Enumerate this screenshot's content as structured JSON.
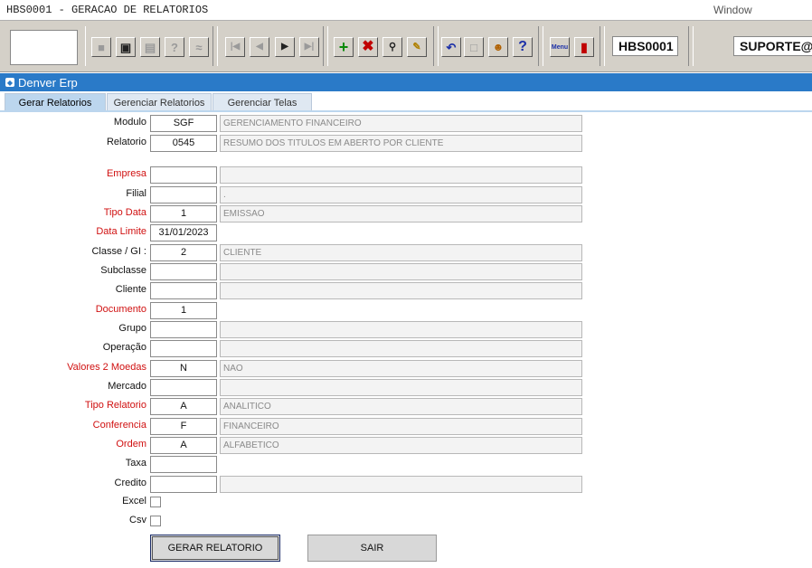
{
  "window": {
    "title": "HBS0001 - GERACAO DE RELATORIOS",
    "menu_label": "Window"
  },
  "toolbar": {
    "icons": [
      "save-icon",
      "window-icon",
      "print-icon",
      "query-icon",
      "execute-icon",
      "first-record-icon",
      "previous-record-icon",
      "next-record-icon",
      "last-record-icon",
      "insert-record-icon",
      "delete-record-icon",
      "search-icon",
      "edit-icon",
      "undo-icon",
      "clipboard-icon",
      "help-agent-icon",
      "help-icon",
      "menu-icon",
      "exit-icon"
    ],
    "menu_icon_label": "Menu",
    "form_code": "HBS0001",
    "user": "SUPORTE@"
  },
  "panel": {
    "title": "Denver Erp"
  },
  "tabs": [
    {
      "label": "Gerar Relatorios",
      "active": true
    },
    {
      "label": "Gerenciar Relatorios",
      "active": false
    },
    {
      "label": "Gerenciar Telas",
      "active": false
    }
  ],
  "fields": {
    "modulo": {
      "label": "Modulo",
      "code": "SGF",
      "desc": "GERENCIAMENTO FINANCEIRO"
    },
    "relatorio": {
      "label": "Relatorio",
      "code": "0545",
      "desc": "RESUMO DOS TITULOS EM ABERTO POR CLIENTE"
    },
    "empresa": {
      "label": "Empresa",
      "code": "",
      "desc": ""
    },
    "filial": {
      "label": "Filial",
      "code": "",
      "desc": "."
    },
    "tipo_data": {
      "label": "Tipo Data",
      "code": "1",
      "desc": "EMISSAO"
    },
    "data_limite": {
      "label": "Data Limite",
      "code": "31/01/2023"
    },
    "classe_gi": {
      "label": "Classe / GI :",
      "code": "2",
      "desc": "CLIENTE"
    },
    "subclasse": {
      "label": "Subclasse",
      "code": "",
      "desc": ""
    },
    "cliente": {
      "label": "Cliente",
      "code": "",
      "desc": ""
    },
    "documento": {
      "label": "Documento",
      "code": "1"
    },
    "grupo": {
      "label": "Grupo",
      "code": "",
      "desc": ""
    },
    "operacao": {
      "label": "Operação",
      "code": "",
      "desc": ""
    },
    "valores_2_moedas": {
      "label": "Valores 2 Moedas",
      "code": "N",
      "desc": "NAO"
    },
    "mercado": {
      "label": "Mercado",
      "code": "",
      "desc": ""
    },
    "tipo_relatorio": {
      "label": "Tipo Relatorio",
      "code": "A",
      "desc": "ANALITICO"
    },
    "conferencia": {
      "label": "Conferencia",
      "code": "F",
      "desc": "FINANCEIRO"
    },
    "ordem": {
      "label": "Ordem",
      "code": "A",
      "desc": "ALFABETICO"
    },
    "taxa": {
      "label": "Taxa",
      "code": ""
    },
    "credito": {
      "label": "Credito",
      "code": "",
      "desc": ""
    },
    "excel": {
      "label": "Excel",
      "checked": false
    },
    "csv": {
      "label": "Csv",
      "checked": false
    }
  },
  "buttons": {
    "generate": "GERAR RELATORIO",
    "exit": "SAIR"
  },
  "colors": {
    "required_label": "#d01010",
    "panel_header": "#2a7ac8",
    "active_tab": "#bcd6ee"
  }
}
